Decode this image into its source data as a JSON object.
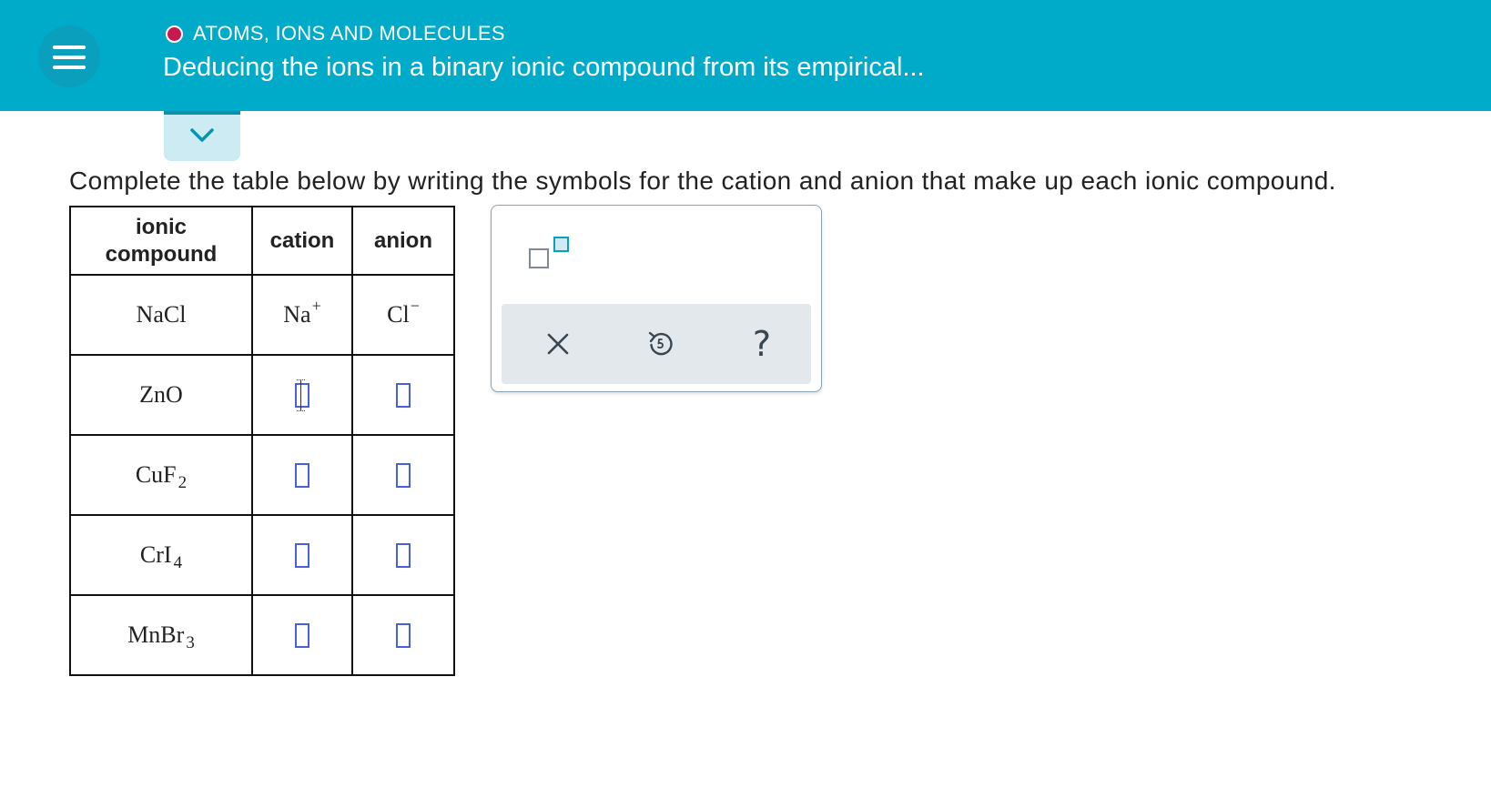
{
  "header": {
    "topic": "ATOMS, IONS AND MOLECULES",
    "title": "Deducing the ions in a binary ionic compound from its empirical...",
    "status_color": "#c8184f",
    "bar_color": "#00aac9"
  },
  "question": {
    "instruction": "Complete the table below by writing the symbols for the cation and anion that make up each ionic compound."
  },
  "table": {
    "headers": {
      "compound_line1": "ionic",
      "compound_line2": "compound",
      "cation": "cation",
      "anion": "anion"
    },
    "rows": [
      {
        "compound": {
          "base": "NaCl",
          "sub": ""
        },
        "cation": {
          "base": "Na",
          "charge": "+"
        },
        "anion": {
          "base": "Cl",
          "charge": "−"
        }
      },
      {
        "compound": {
          "base": "ZnO",
          "sub": ""
        },
        "cation": null,
        "anion": null
      },
      {
        "compound": {
          "base": "CuF",
          "sub": "2"
        },
        "cation": null,
        "anion": null
      },
      {
        "compound": {
          "base": "CrI",
          "sub": "4"
        },
        "cation": null,
        "anion": null
      },
      {
        "compound": {
          "base": "MnBr",
          "sub": "3"
        },
        "cation": null,
        "anion": null
      }
    ]
  },
  "tools": {
    "superscript_icon": "superscript-box-icon",
    "clear_icon": "x-icon",
    "undo_icon": "undo-icon",
    "help_label": "?"
  }
}
